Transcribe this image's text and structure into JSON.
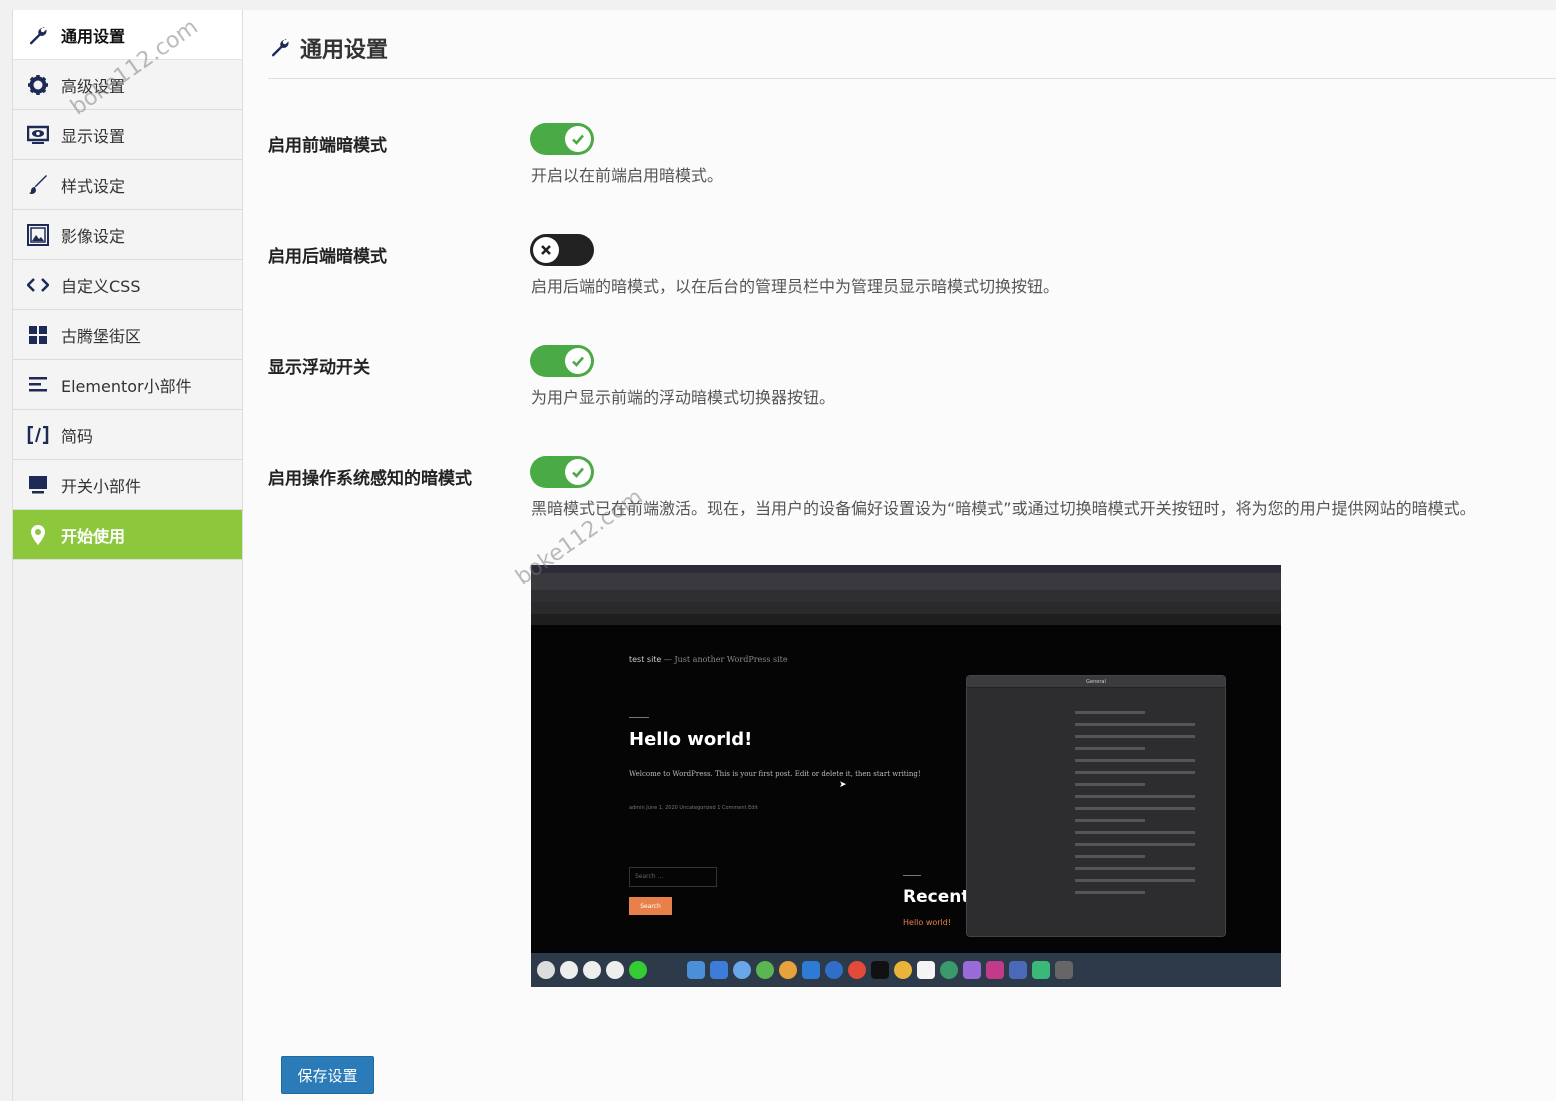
{
  "sidebar": {
    "items": [
      {
        "label": "通用设置",
        "icon": "wrench-icon"
      },
      {
        "label": "高级设置",
        "icon": "gear-icon"
      },
      {
        "label": "显示设置",
        "icon": "monitor-eye-icon"
      },
      {
        "label": "样式设定",
        "icon": "brush-icon"
      },
      {
        "label": "影像设定",
        "icon": "image-icon"
      },
      {
        "label": "自定义CSS",
        "icon": "code-icon"
      },
      {
        "label": "古腾堡街区",
        "icon": "blocks-icon"
      },
      {
        "label": "Elementor小部件",
        "icon": "elementor-icon"
      },
      {
        "label": "简码",
        "icon": "shortcode-icon"
      },
      {
        "label": "开关小部件",
        "icon": "desktop-icon"
      },
      {
        "label": "开始使用",
        "icon": "location-pin-icon"
      }
    ]
  },
  "main": {
    "title": "通用设置",
    "settings": [
      {
        "label": "启用前端暗模式",
        "enabled": true,
        "description": "开启以在前端启用暗模式。"
      },
      {
        "label": "启用后端暗模式",
        "enabled": false,
        "description": "启用后端的暗模式，以在后台的管理员栏中为管理员显示暗模式切换按钮。"
      },
      {
        "label": "显示浮动开关",
        "enabled": true,
        "description": "为用户显示前端的浮动暗模式切换器按钮。"
      },
      {
        "label": "启用操作系统感知的暗模式",
        "enabled": true,
        "description": "黑暗模式已在前端激活。现在，当用户的设备偏好设置设为“暗模式”或通过切换暗模式开关按钮时，将为您的用户提供网站的暗模式。"
      }
    ],
    "screenshot": {
      "site_name": "test site",
      "site_tagline": "— Just another WordPress site",
      "post_title": "Hello world!",
      "post_text": "Welcome to WordPress. This is your first post. Edit or delete it, then start writing!",
      "post_meta": "admin   June 1, 2020   Uncategorized   1 Comment   Edit",
      "search_placeholder": "Search ...",
      "search_button": "Search",
      "recent_heading": "Recent",
      "recent_link": "Hello world!",
      "prefs_title": "General"
    },
    "save_button": "保存设置"
  },
  "watermarks": [
    "boke112.com",
    "boke112.com"
  ],
  "colors": {
    "accent_green": "#8dc83c",
    "toggle_on": "#4aaa45",
    "toggle_off": "#222222",
    "save_blue": "#2a7bb8"
  }
}
